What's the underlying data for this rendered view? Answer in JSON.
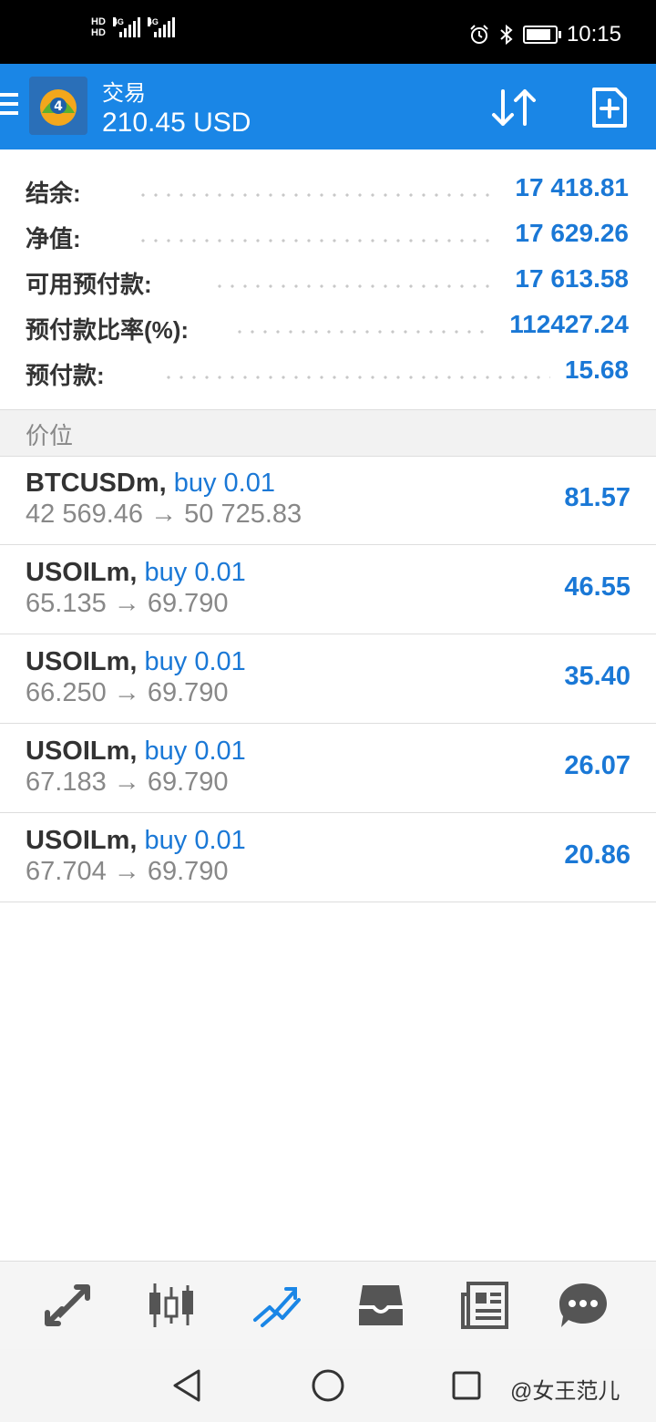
{
  "status_bar": {
    "time": "10:15",
    "network": "4G",
    "hd1": "HD",
    "hd2": "HD",
    "icons": [
      "alarm-icon",
      "bluetooth-icon",
      "battery-icon"
    ],
    "battery_level": 0.85
  },
  "app_bar": {
    "title": "交易",
    "subtitle": "210.45 USD",
    "icons": [
      "menu-icon",
      "metatrader-logo",
      "sort-icon",
      "new-order-icon"
    ]
  },
  "summary": [
    {
      "label": "结余:",
      "value": "17 418.81"
    },
    {
      "label": "净值:",
      "value": "17 629.26"
    },
    {
      "label": "可用预付款:",
      "value": "17 613.58"
    },
    {
      "label": "预付款比率(%):",
      "value": "112427.24"
    },
    {
      "label": "预付款:",
      "value": "15.68"
    }
  ],
  "section": {
    "label": "价位"
  },
  "positions": [
    {
      "symbol": "BTCUSDm,",
      "type": " buy 0.01",
      "prices": "42 569.46 → 50 725.83",
      "profit": "81.57"
    },
    {
      "symbol": "USOILm,",
      "type": " buy 0.01",
      "prices": "65.135 → 69.790",
      "profit": "46.55"
    },
    {
      "symbol": "USOILm,",
      "type": " buy 0.01",
      "prices": "66.250 → 69.790",
      "profit": "35.40"
    },
    {
      "symbol": "USOILm,",
      "type": " buy 0.01",
      "prices": "67.183 → 69.790",
      "profit": "26.07"
    },
    {
      "symbol": "USOILm,",
      "type": " buy 0.01",
      "prices": "67.704 → 69.790",
      "profit": "20.86"
    }
  ],
  "tab_bar": {
    "tabs": [
      "quotes-icon",
      "chart-icon",
      "trade-icon",
      "history-icon",
      "news-icon",
      "chat-icon"
    ],
    "active_tab": "trade-icon",
    "colors": {
      "active": "#1a86e6",
      "inactive": "#555555"
    }
  },
  "nav_bar": {
    "buttons": [
      "back-icon",
      "home-icon",
      "recents-icon"
    ],
    "watermark": "@女王范儿"
  },
  "colors": {
    "accent": "#1a86e6",
    "value_blue": "#1a78d6",
    "label": "#333333",
    "muted": "#888888"
  }
}
